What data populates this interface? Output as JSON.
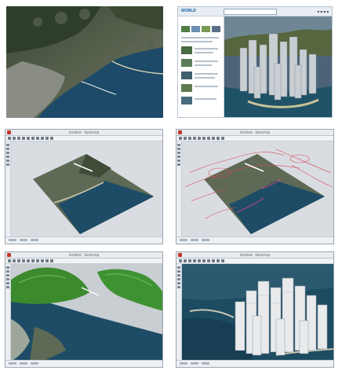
{
  "panels": [
    {
      "name": "aerial-photo"
    },
    {
      "name": "3d-map-portal",
      "logo": "WORLD"
    },
    {
      "name": "cad-terrain-photo",
      "title": "Untitled - SketchUp"
    },
    {
      "name": "cad-terrain-contours",
      "title": "Untitled - SketchUp"
    },
    {
      "name": "cad-terrain-hills",
      "title": "Untitled - SketchUp"
    },
    {
      "name": "cad-city-model",
      "title": "Untitled - SketchUp"
    }
  ],
  "colors": {
    "sea": "#1d4a66",
    "land": "#6b7a6a",
    "terrain": "#3e8f2e",
    "contour": "#d9485a",
    "ui_bg": "#d9dde2"
  }
}
